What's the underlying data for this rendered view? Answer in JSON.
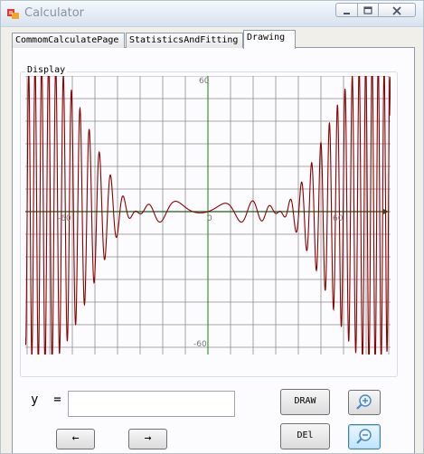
{
  "window": {
    "title": "Calculator"
  },
  "tabs": [
    {
      "label": "CommomCalculatePage",
      "active": false
    },
    {
      "label": "StatisticsAndFitting",
      "active": false
    },
    {
      "label": "Drawing",
      "active": true
    }
  ],
  "display": {
    "label": "Display",
    "tick_labels": {
      "x_neg": "-60",
      "x_zero": "0",
      "x_pos": "60",
      "y_top": "60",
      "y_bottom": "-60"
    },
    "grid_color": "#8c8c8c",
    "axis_x_color": "#1b5e20",
    "axis_y_color": "#1b7d1b",
    "curve_color": "#8b0000"
  },
  "form": {
    "y_label": "y  =",
    "y_value": ""
  },
  "buttons": {
    "draw": "DRAW",
    "del": "DEl",
    "left": "←",
    "right": "→"
  }
}
